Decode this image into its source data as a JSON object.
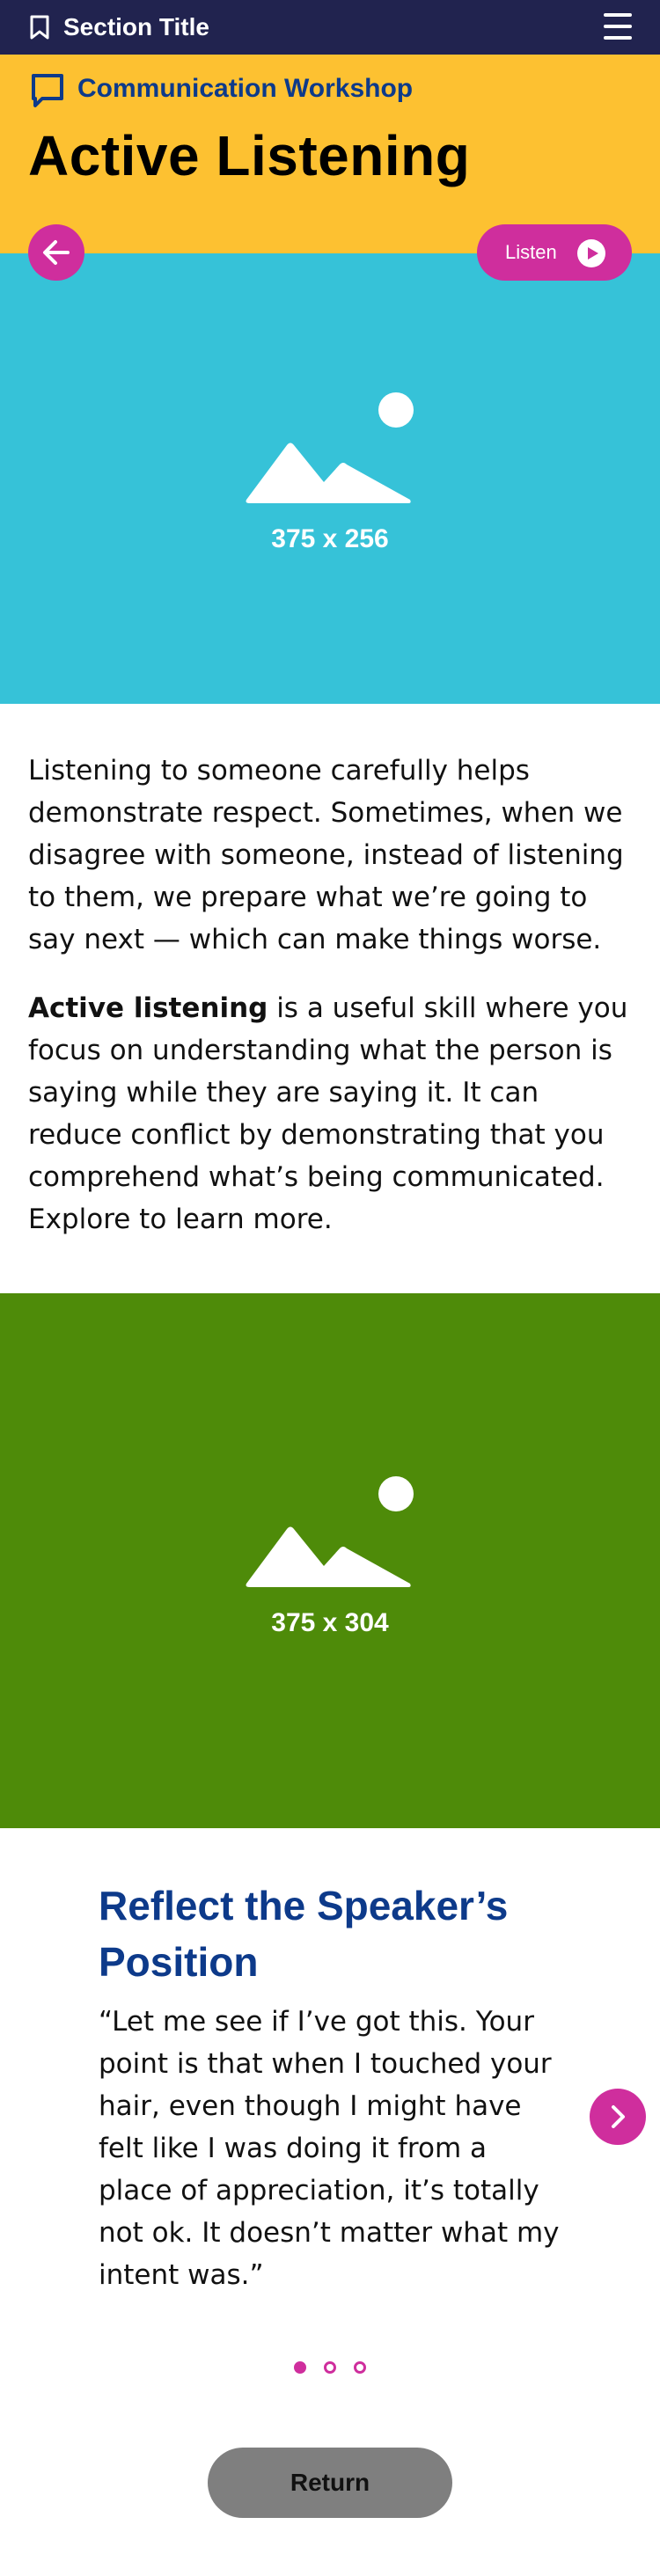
{
  "topbar": {
    "section_title": "Section Title",
    "bookmark_icon": "bookmark-icon",
    "menu_icon": "hamburger-menu-icon"
  },
  "header": {
    "subtitle": "Communication Workshop",
    "title": "Active Listening",
    "chat_icon": "chat-bubble-icon",
    "background_color": "#fdc131"
  },
  "controls": {
    "back_icon": "arrow-left-icon",
    "listen_label": "Listen",
    "play_icon": "play-icon",
    "accent_color": "#cf2e9d"
  },
  "hero": {
    "placeholder_label": "375 x 256",
    "icon": "image-placeholder-icon",
    "background_color": "#36c2d8"
  },
  "body": {
    "paragraph1": "Listening to someone carefully helps demonstrate respect. Sometimes, when we disagree with someone, instead of listening to them, we prepare what we’re going to say next — which can make things worse.",
    "paragraph2_bold": "Active listening",
    "paragraph2_rest": " is a useful skill where you focus on understanding what the person is saying while they are saying it. It can reduce conflict by demonstrating that you comprehend what’s being communicated. Explore to learn more."
  },
  "media": {
    "placeholder_label": "375 x 304",
    "icon": "image-placeholder-icon",
    "background_color": "#4e8b09"
  },
  "carousel": {
    "heading": "Reflect the Speaker’s Position",
    "quote": "“Let me see if I’ve got this. Your point is that when I touched your hair, even though I might have felt like I was doing it from a place of appreciation, it’s totally not ok. It doesn’t matter what my intent was.”",
    "next_icon": "chevron-right-icon",
    "total_slides": 3,
    "active_slide": 1
  },
  "footer": {
    "return_label": "Return"
  }
}
